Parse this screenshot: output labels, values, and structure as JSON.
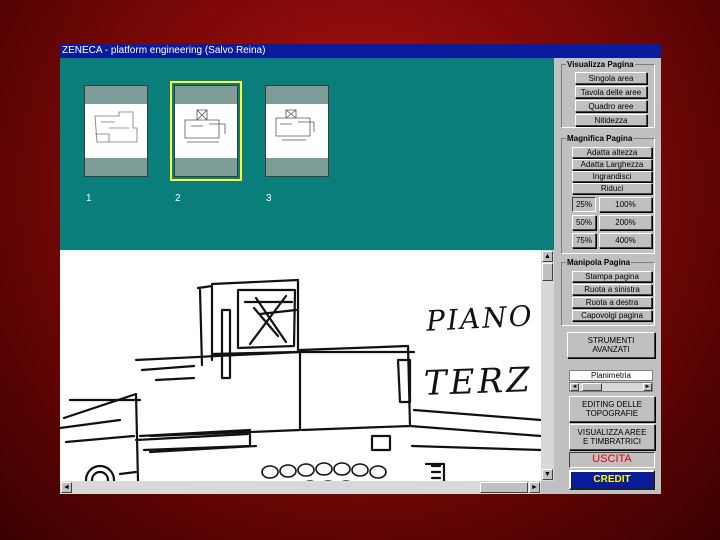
{
  "window": {
    "title": "ZENECA - platform engineering (Salvo Reina)"
  },
  "thumbnails": [
    {
      "number": "1",
      "selected": false
    },
    {
      "number": "2",
      "selected": true
    },
    {
      "number": "3",
      "selected": false
    }
  ],
  "viewer": {
    "handwritten": {
      "line1": "PIANO",
      "line2": "TERZ"
    }
  },
  "panel": {
    "visualizza": {
      "title": "Visualizza Pagina",
      "buttons": [
        "Singola area",
        "Tavola delle aree",
        "Quadro aree",
        "Nitidezza"
      ]
    },
    "magnifica": {
      "title": "Magnifica Pagina",
      "buttons": [
        "Adatta altezza",
        "Adatta Larghezza",
        "Ingrandisci",
        "Riduci"
      ],
      "zoom": [
        "25%",
        "100%",
        "50%",
        "200%",
        "75%",
        "400%"
      ],
      "zoom_selected": "25%"
    },
    "manipola": {
      "title": "Manipola Pagina",
      "buttons": [
        "Stampa pagina",
        "Ruota a sinistra",
        "Ruota a destra",
        "Capovolgi pagina"
      ]
    },
    "strumenti": "STRUMENTI\nAVANZATI",
    "layer_label": "Planimetria",
    "editing": "EDITING DELLE\nTOPOGRAFIE",
    "visualizza_aree": "VISUALIZZA AREE\nE TIMBRATRICI",
    "uscita": "USCITA",
    "credit": "CREDIT"
  },
  "colors": {
    "background": "#8a0a0a",
    "titlebar": "#0a1c9c",
    "thumb_panel": "#0a7e7a",
    "selected_outline": "#ffff33",
    "uscita_text": "#e00000",
    "credit_text": "#ffff00"
  },
  "icons": {
    "scroll_up": "▲",
    "scroll_down": "▼",
    "scroll_left": "◄",
    "scroll_right": "►"
  }
}
